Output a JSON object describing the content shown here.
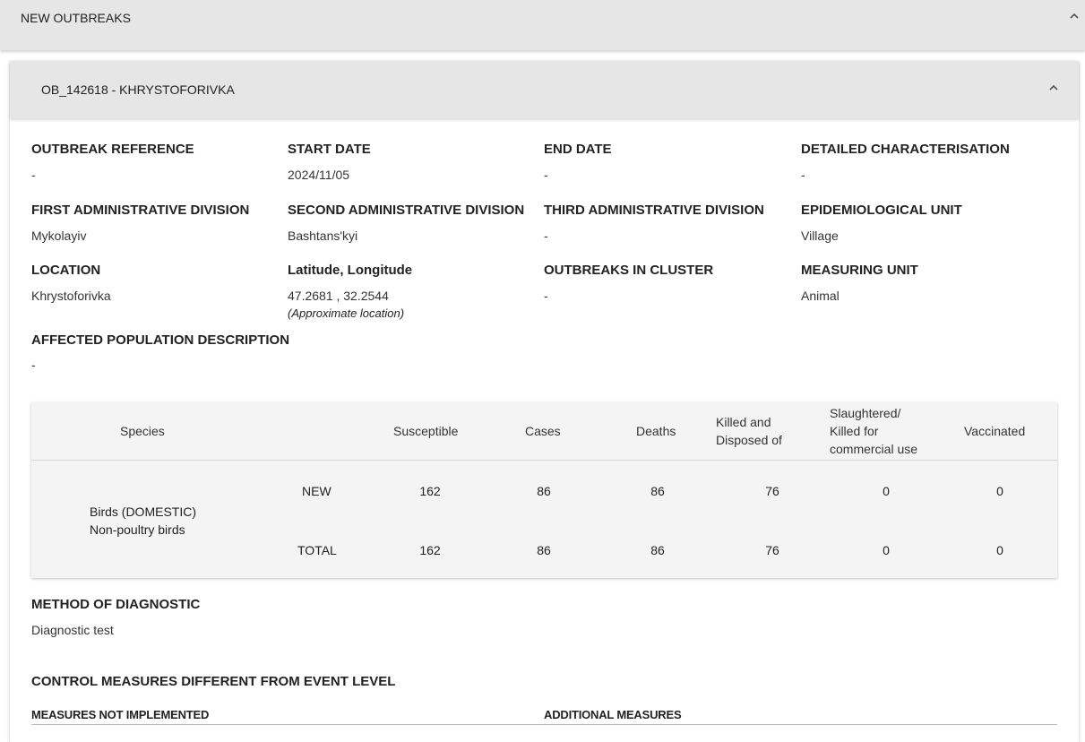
{
  "section": {
    "title": "NEW OUTBREAKS"
  },
  "outbreak": {
    "title": "OB_142618 - KHRYSTOFORIVKA",
    "fields": {
      "outbreak_reference": {
        "label": "OUTBREAK REFERENCE",
        "value": "-"
      },
      "start_date": {
        "label": "START DATE",
        "value": "2024/11/05"
      },
      "end_date": {
        "label": "END DATE",
        "value": "-"
      },
      "detailed_characterisation": {
        "label": "DETAILED CHARACTERISATION",
        "value": "-"
      },
      "first_admin": {
        "label": "FIRST ADMINISTRATIVE DIVISION",
        "value": "Mykolayiv"
      },
      "second_admin": {
        "label": "SECOND ADMINISTRATIVE DIVISION",
        "value": "Bashtans'kyi"
      },
      "third_admin": {
        "label": "THIRD ADMINISTRATIVE DIVISION",
        "value": "-"
      },
      "epi_unit": {
        "label": "EPIDEMIOLOGICAL UNIT",
        "value": "Village"
      },
      "location": {
        "label": "LOCATION",
        "value": "Khrystoforivka"
      },
      "lat_long": {
        "label": "Latitude, Longitude",
        "value": "47.2681 , 32.2544",
        "note": "(Approximate location)"
      },
      "outbreaks_in_cluster": {
        "label": "OUTBREAKS IN CLUSTER",
        "value": "-"
      },
      "measuring_unit": {
        "label": "MEASURING UNIT",
        "value": "Animal"
      },
      "affected_population": {
        "label": "AFFECTED POPULATION DESCRIPTION",
        "value": "-"
      }
    },
    "table": {
      "headers": {
        "species": "Species",
        "susceptible": "Susceptible",
        "cases": "Cases",
        "deaths": "Deaths",
        "killed_1": "Killed and",
        "killed_2": "Disposed of",
        "slaughtered_1": "Slaughtered/",
        "slaughtered_2": "Killed for",
        "slaughtered_3": "commercial use",
        "vaccinated": "Vaccinated"
      },
      "species_line1": "Birds (DOMESTIC)",
      "species_line2": "Non-poultry birds",
      "rows": [
        {
          "label": "NEW",
          "susceptible": "162",
          "cases": "86",
          "deaths": "86",
          "killed": "76",
          "slaughtered": "0",
          "vaccinated": "0"
        },
        {
          "label": "TOTAL",
          "susceptible": "162",
          "cases": "86",
          "deaths": "86",
          "killed": "76",
          "slaughtered": "0",
          "vaccinated": "0"
        }
      ]
    },
    "method_of_diagnostic": {
      "label": "METHOD OF DIAGNOSTIC",
      "value": "Diagnostic test"
    },
    "control_measures": {
      "title": "CONTROL MEASURES DIFFERENT FROM EVENT LEVEL",
      "not_implemented": "MEASURES NOT IMPLEMENTED",
      "additional": "ADDITIONAL MEASURES"
    }
  },
  "icons": {
    "collapse": "chevron-up-icon"
  }
}
